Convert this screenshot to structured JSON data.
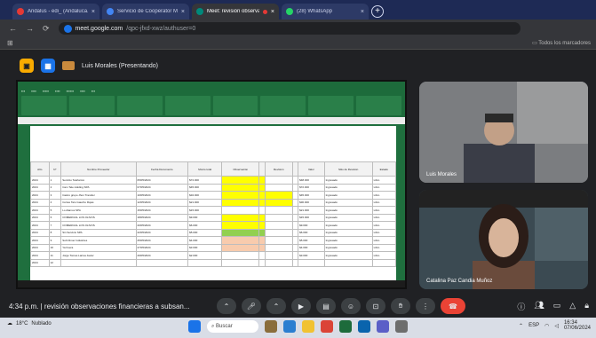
{
  "browser": {
    "tabs": [
      {
        "label": "Andalus - edi_ (Andaluca.cal)",
        "color": "#e53935"
      },
      {
        "label": "Servicio de Cooperator Meri...",
        "color": "#4285f4"
      },
      {
        "label": "Meet: revisión observaciones...",
        "color": "#00897b",
        "recording": true
      },
      {
        "label": "(28) WhatsApp",
        "color": "#25d366"
      }
    ],
    "new_tab": "+",
    "url_host": "meet.google.com",
    "url_path": "/qpc-jfxd-xwz/authuser=0",
    "bookmarks_all": "Todos los marcadores"
  },
  "meet": {
    "presenter": "Luis Morales (Presentando)",
    "participants": [
      {
        "name": "Luis Morales"
      },
      {
        "name": "Catalina Paz Candia Muñoz"
      }
    ],
    "time": "4:34 p.m.",
    "meeting_title": "revisión observaciones financieras a subsan...",
    "separator": "|"
  },
  "spreadsheet": {
    "headers": [
      "Año",
      "N°",
      "Nombre Proveedor",
      "Fecha Documento",
      "Monto total",
      "Observación",
      "",
      "Revisión",
      "",
      "Valor",
      "Sitio de Revisión",
      "Estado"
    ],
    "rows": [
      {
        "cells": [
          "2024",
          "1",
          "Servicio Telefonico",
          "05/05/2024",
          "$72.000",
          "",
          "",
          "",
          "",
          "$48.000",
          "Ingresado",
          "Libro"
        ],
        "hl": "yel"
      },
      {
        "cells": [
          "2024",
          "2",
          "Cam Tele Holding SPA",
          "07/05/2024",
          "$45.000",
          "",
          "",
          "",
          "",
          "$72.000",
          "Ingresado",
          "Libro"
        ],
        "hl": "yel"
      },
      {
        "cells": [
          "2024",
          "3",
          "Castro grupo Jhon Transfer",
          "10/05/2024",
          "$32.000",
          "",
          "",
          "",
          "",
          "$45.000",
          "Ingresado",
          "Libro"
        ],
        "hl": "yel"
      },
      {
        "cells": [
          "2024",
          "4",
          "Cortes Taro Gaucho Rojas",
          "12/05/2024",
          "$21.000",
          "",
          "",
          "",
          "",
          "$30.000",
          "Ingresado",
          "Libro"
        ],
        "hl": "yel"
      },
      {
        "cells": [
          "2024",
          "5",
          "Lo Alamos SPA",
          "15/05/2024",
          "$15.000",
          "",
          "",
          "",
          "",
          "$21.000",
          "Ingresado",
          "Libro"
        ],
        "hl": ""
      },
      {
        "cells": [
          "2024",
          "6",
          "COMERCIAL LOS OLIVOS",
          "18/05/2024",
          "$9.000",
          "",
          "",
          "",
          "",
          "$15.000",
          "Ingresado",
          "Libro"
        ],
        "hl": "yel"
      },
      {
        "cells": [
          "2024",
          "7",
          "COMERCIAL LOS OLIVOS",
          "20/05/2024",
          "$6.000",
          "",
          "",
          "",
          "",
          "$9.000",
          "Ingresado",
          "Libro"
        ],
        "hl": "yel"
      },
      {
        "cells": [
          "2024",
          "8",
          "Sin Servicio SPA",
          "22/05/2024",
          "$5.000",
          "",
          "",
          "",
          "",
          "$6.000",
          "Ingresado",
          "Libro"
        ],
        "hl": "grn"
      },
      {
        "cells": [
          "2024",
          "9",
          "Sub Dimer Industries",
          "25/05/2024",
          "$4.000",
          "",
          "",
          "",
          "",
          "$5.000",
          "Ingresado",
          "Libro"
        ],
        "hl": "org"
      },
      {
        "cells": [
          "2024",
          "10",
          "Ya Fuera",
          "27/05/2024",
          "$3.000",
          "",
          "",
          "",
          "",
          "$4.000",
          "Ingresado",
          "Libro"
        ],
        "hl": "org"
      },
      {
        "cells": [
          "2024",
          "11",
          "Jorge Tomas Larrea Javier",
          "29/05/2024",
          "$2.000",
          "",
          "",
          "",
          "",
          "$3.000",
          "Ingresado",
          "Libro"
        ],
        "hl": ""
      },
      {
        "cells": [
          "2024",
          "12",
          "",
          "",
          "",
          "",
          "",
          "",
          "",
          "",
          "",
          ""
        ],
        "hl": ""
      }
    ]
  },
  "taskbar": {
    "weather_temp": "18°C",
    "weather_desc": "Nublado",
    "search": "Buscar",
    "clock_time": "16:34",
    "clock_date": "07/06/2024",
    "lang": "ESP"
  }
}
